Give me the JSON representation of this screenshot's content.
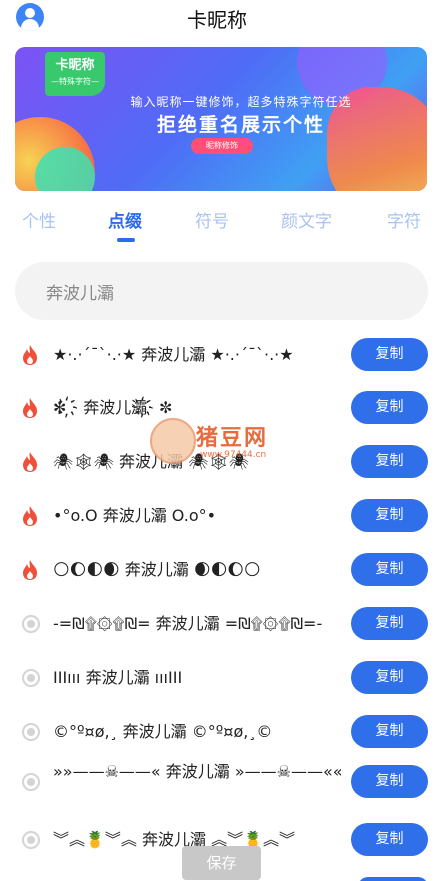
{
  "app": {
    "title": "卡昵称"
  },
  "banner": {
    "tag_title": "卡昵称",
    "tag_subtitle": "—特殊字符—",
    "line1": "输入昵称一键修饰，超多特殊字符任选",
    "line2": "拒绝重名展示个性",
    "button": "昵称修饰"
  },
  "tabs": [
    {
      "label": "个性",
      "active": false
    },
    {
      "label": "点缀",
      "active": true
    },
    {
      "label": "符号",
      "active": false
    },
    {
      "label": "颜文字",
      "active": false
    },
    {
      "label": "字符",
      "active": false
    }
  ],
  "search": {
    "value": "奔波儿灞"
  },
  "rows": [
    {
      "icon": "flame-icon",
      "text": "★·.·´¯`·.·★ 奔波儿灞 ★·.·´¯`·.·★",
      "copy": "复制"
    },
    {
      "icon": "flame-icon",
      "text": "✼ ҉ 奔波儿灞҉ ✼",
      "copy": "复制"
    },
    {
      "icon": "flame-icon",
      "text": "🕷🕸🕷 奔波儿灞 🕷🕸🕷",
      "copy": "复制"
    },
    {
      "icon": "flame-icon",
      "text": "•°o.O 奔波儿灞 O.o°•",
      "copy": "复制"
    },
    {
      "icon": "flame-icon",
      "text": "🌕🌔🌓🌒 奔波儿灞 🌒🌓🌔🌕",
      "copy": "复制"
    },
    {
      "icon": "radio-icon",
      "text": "-=₪۩۞۩₪= 奔波儿灞 =₪۩۞۩₪=-",
      "copy": "复制"
    },
    {
      "icon": "radio-icon",
      "text": "ΙΙΙııı 奔波儿灞 ıııΙΙΙ",
      "copy": "复制"
    },
    {
      "icon": "radio-icon",
      "text": "©°º¤ø,¸ 奔波儿灞 ©°º¤ø,¸©",
      "copy": "复制"
    },
    {
      "icon": "radio-icon",
      "text": "»»——☠——« 奔波儿灞 »——☠——««",
      "copy": "复制"
    },
    {
      "icon": "radio-icon",
      "text": "︾︽🍍︾︽ 奔波儿灞 ︽︾🍍︽︾",
      "copy": "复制"
    }
  ],
  "watermark": {
    "text": "猪豆网",
    "url": "www.97444.cn"
  },
  "footer": {
    "save": "保存"
  },
  "colors": {
    "accent": "#2f6fe9",
    "tab_inactive": "#a9c3ef",
    "flame": "#f0503a"
  }
}
